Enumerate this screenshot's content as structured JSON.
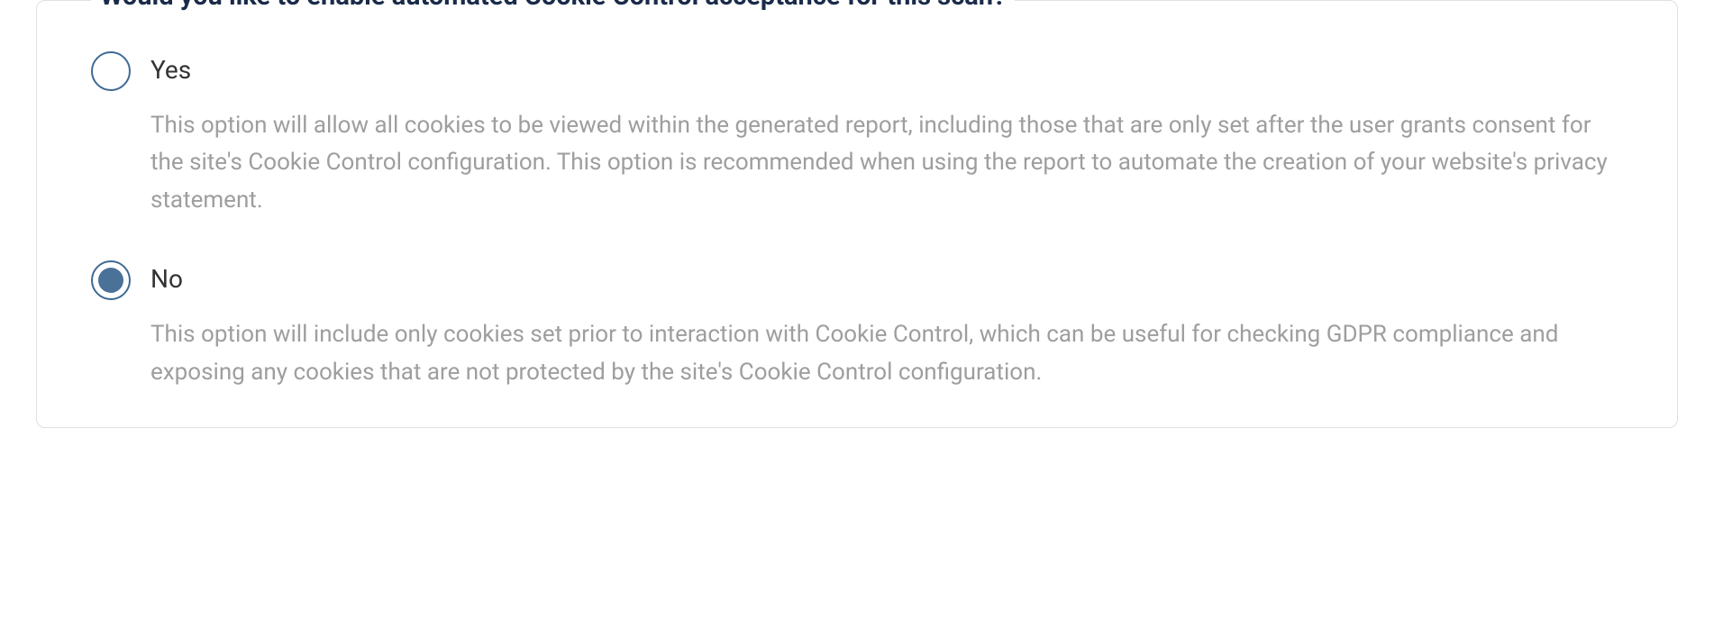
{
  "question": "Would you like to enable automated Cookie Control acceptance for this scan?",
  "options": {
    "yes": {
      "label": "Yes",
      "description": "This option will allow all cookies to be viewed within the generated report, including those that are only set after the user grants consent for the site's Cookie Control configuration. This option is recommended when using the report to automate the creation of your website's privacy statement.",
      "selected": false
    },
    "no": {
      "label": "No",
      "description": "This option will include only cookies set prior to interaction with Cookie Control, which can be useful for checking GDPR compliance and exposing any cookies that are not protected by the site's Cookie Control configuration.",
      "selected": true
    }
  }
}
